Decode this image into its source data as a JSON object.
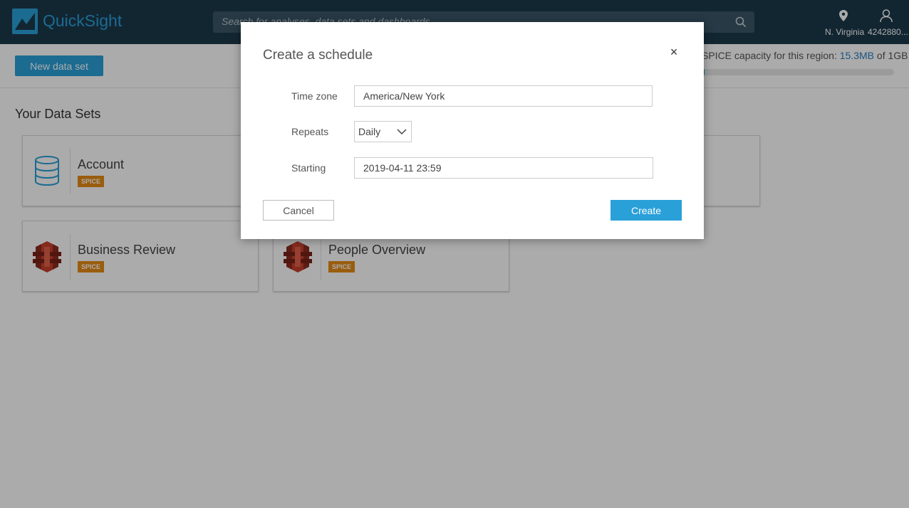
{
  "topbar": {
    "brand": "QuickSight",
    "search_placeholder": "Search for analyses, data sets and dashboards",
    "region": "N. Virginia",
    "account": "4242880..."
  },
  "subbar": {
    "new_data_set_label": "New data set",
    "capacity_prefix": "SPICE capacity for this region: ",
    "capacity_used": "15.3MB",
    "capacity_mid": " of ",
    "capacity_total": "1GB",
    "capacity_fraction": 0.015
  },
  "main": {
    "section_title": "Your Data Sets",
    "cards": [
      {
        "title": "Account",
        "badge": "SPICE",
        "icon": "database-icon"
      },
      {
        "title": "Business Review",
        "badge": "SPICE",
        "icon": "s3-bucket-icon"
      },
      {
        "title": "People Overview",
        "badge": "SPICE",
        "icon": "s3-bucket-icon"
      }
    ]
  },
  "modal": {
    "title": "Create a schedule",
    "close_glyph": "×",
    "time_zone_label": "Time zone",
    "time_zone_value": "America/New York",
    "repeats_label": "Repeats",
    "repeats_value": "Daily",
    "starting_label": "Starting",
    "starting_value": "2019-04-11 23:59",
    "cancel_label": "Cancel",
    "create_label": "Create"
  },
  "colors": {
    "topbar": "#1b3a4b",
    "accent": "#2aa0d9",
    "badge": "#e68b14",
    "s3": "#c7402d"
  }
}
